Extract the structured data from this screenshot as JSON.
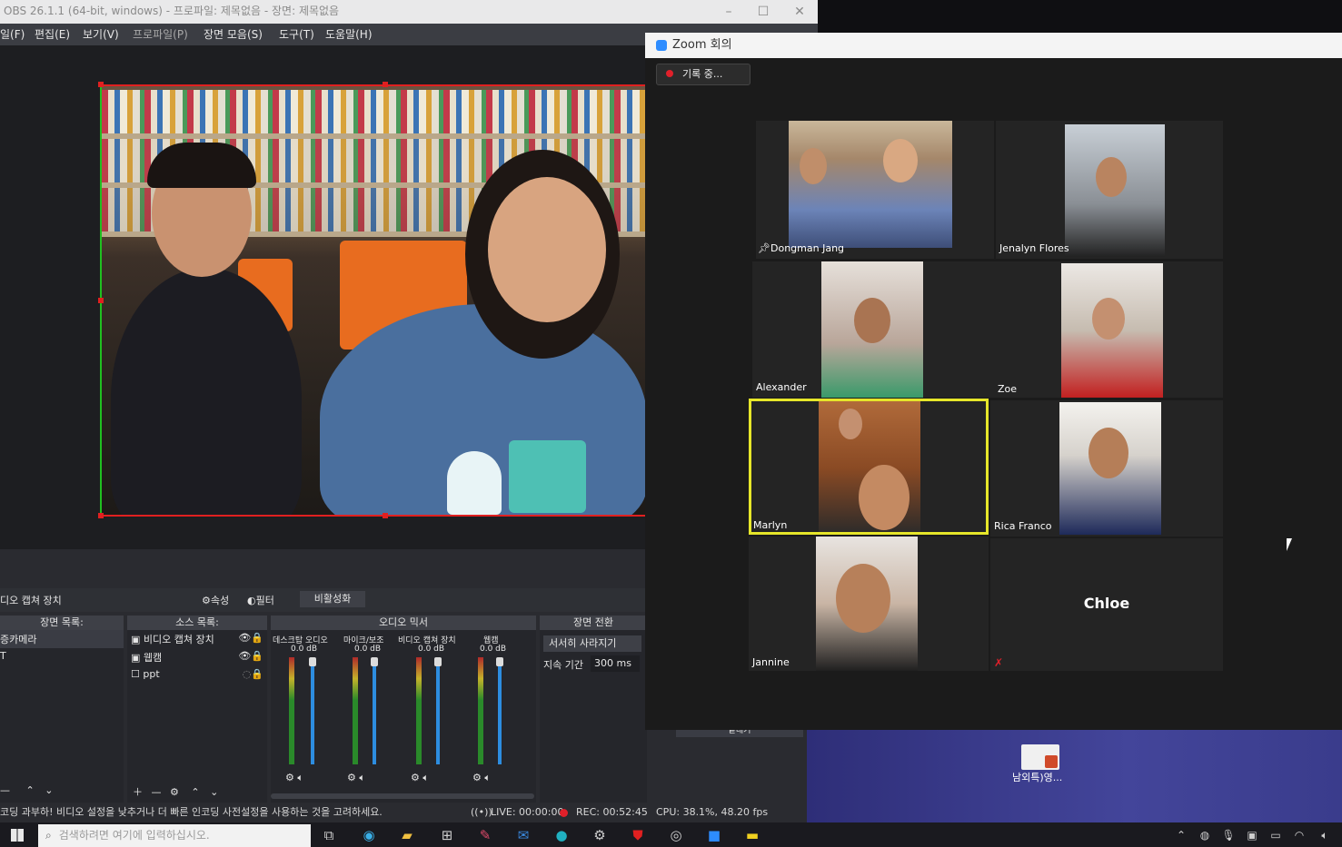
{
  "obs": {
    "title": "OBS 26.1.1 (64-bit, windows) - 프로파일: 제목없음 - 장면: 제목없음",
    "menu": [
      "일(F)",
      "편집(E)",
      "보기(V)",
      "프로파일(P)",
      "장면 모음(S)",
      "도구(T)",
      "도움말(H)"
    ],
    "source_bar": {
      "label": "디오 캡쳐 장치",
      "properties": "속성",
      "filters": "필터",
      "deactivate": "비활성화"
    },
    "scenes": {
      "header": "장면 목록:",
      "items": [
        "증카메라",
        "T"
      ]
    },
    "sources": {
      "header": "소스 목록:",
      "items": [
        "비디오 캡쳐 장치",
        "웹캠",
        "ppt"
      ]
    },
    "mixer": {
      "header": "오디오 믹서",
      "channels": [
        {
          "name": "데스크탑 오디오",
          "db": "0.0 dB"
        },
        {
          "name": "마이크/보조",
          "db": "0.0 dB"
        },
        {
          "name": "비디오 캡쳐 장치",
          "db": "0.0 dB"
        },
        {
          "name": "웹캠",
          "db": "0.0 dB"
        }
      ],
      "scale": [
        "0",
        "-5",
        "-10",
        "-15",
        "-20",
        "-25",
        "-30",
        "-35",
        "-40",
        "-45",
        "-50",
        "-55",
        "-60"
      ]
    },
    "transitions": {
      "header": "장면 전환",
      "selected": "서서히 사라지기",
      "duration_label": "지속 기간",
      "duration_value": "300 ms",
      "export_label": "끝내기"
    },
    "status": {
      "warning": "코딩 과부하! 비디오 설정을 낮추거나 더 빠른 인코딩 사전설정을 사용하는 것을 고려하세요.",
      "live": "LIVE: 00:00:00",
      "rec": "REC: 00:52:45",
      "cpu": "CPU: 38.1%, 48.20 fps"
    }
  },
  "zoom": {
    "title": "Zoom 회의",
    "recording_label": "기록 중...",
    "participants": [
      {
        "name": "Dongman Jang",
        "pinned": true
      },
      {
        "name": "Jenalyn Flores"
      },
      {
        "name": "Alexander"
      },
      {
        "name": "Zoe"
      },
      {
        "name": "Marlyn",
        "active_speaker": true
      },
      {
        "name": "Rica Franco"
      },
      {
        "name": "Jannine"
      },
      {
        "name": "Chloe",
        "video_off": true
      }
    ]
  },
  "desktop": {
    "file_label": "남외특)영..."
  },
  "taskbar": {
    "search_placeholder": "검색하려면 여기에 입력하십시오."
  },
  "colors": {
    "selection_red": "#e02020",
    "active_speaker": "#e6e62a",
    "fader_blue": "#2d8de0",
    "rec_dot": "#e0202a"
  }
}
